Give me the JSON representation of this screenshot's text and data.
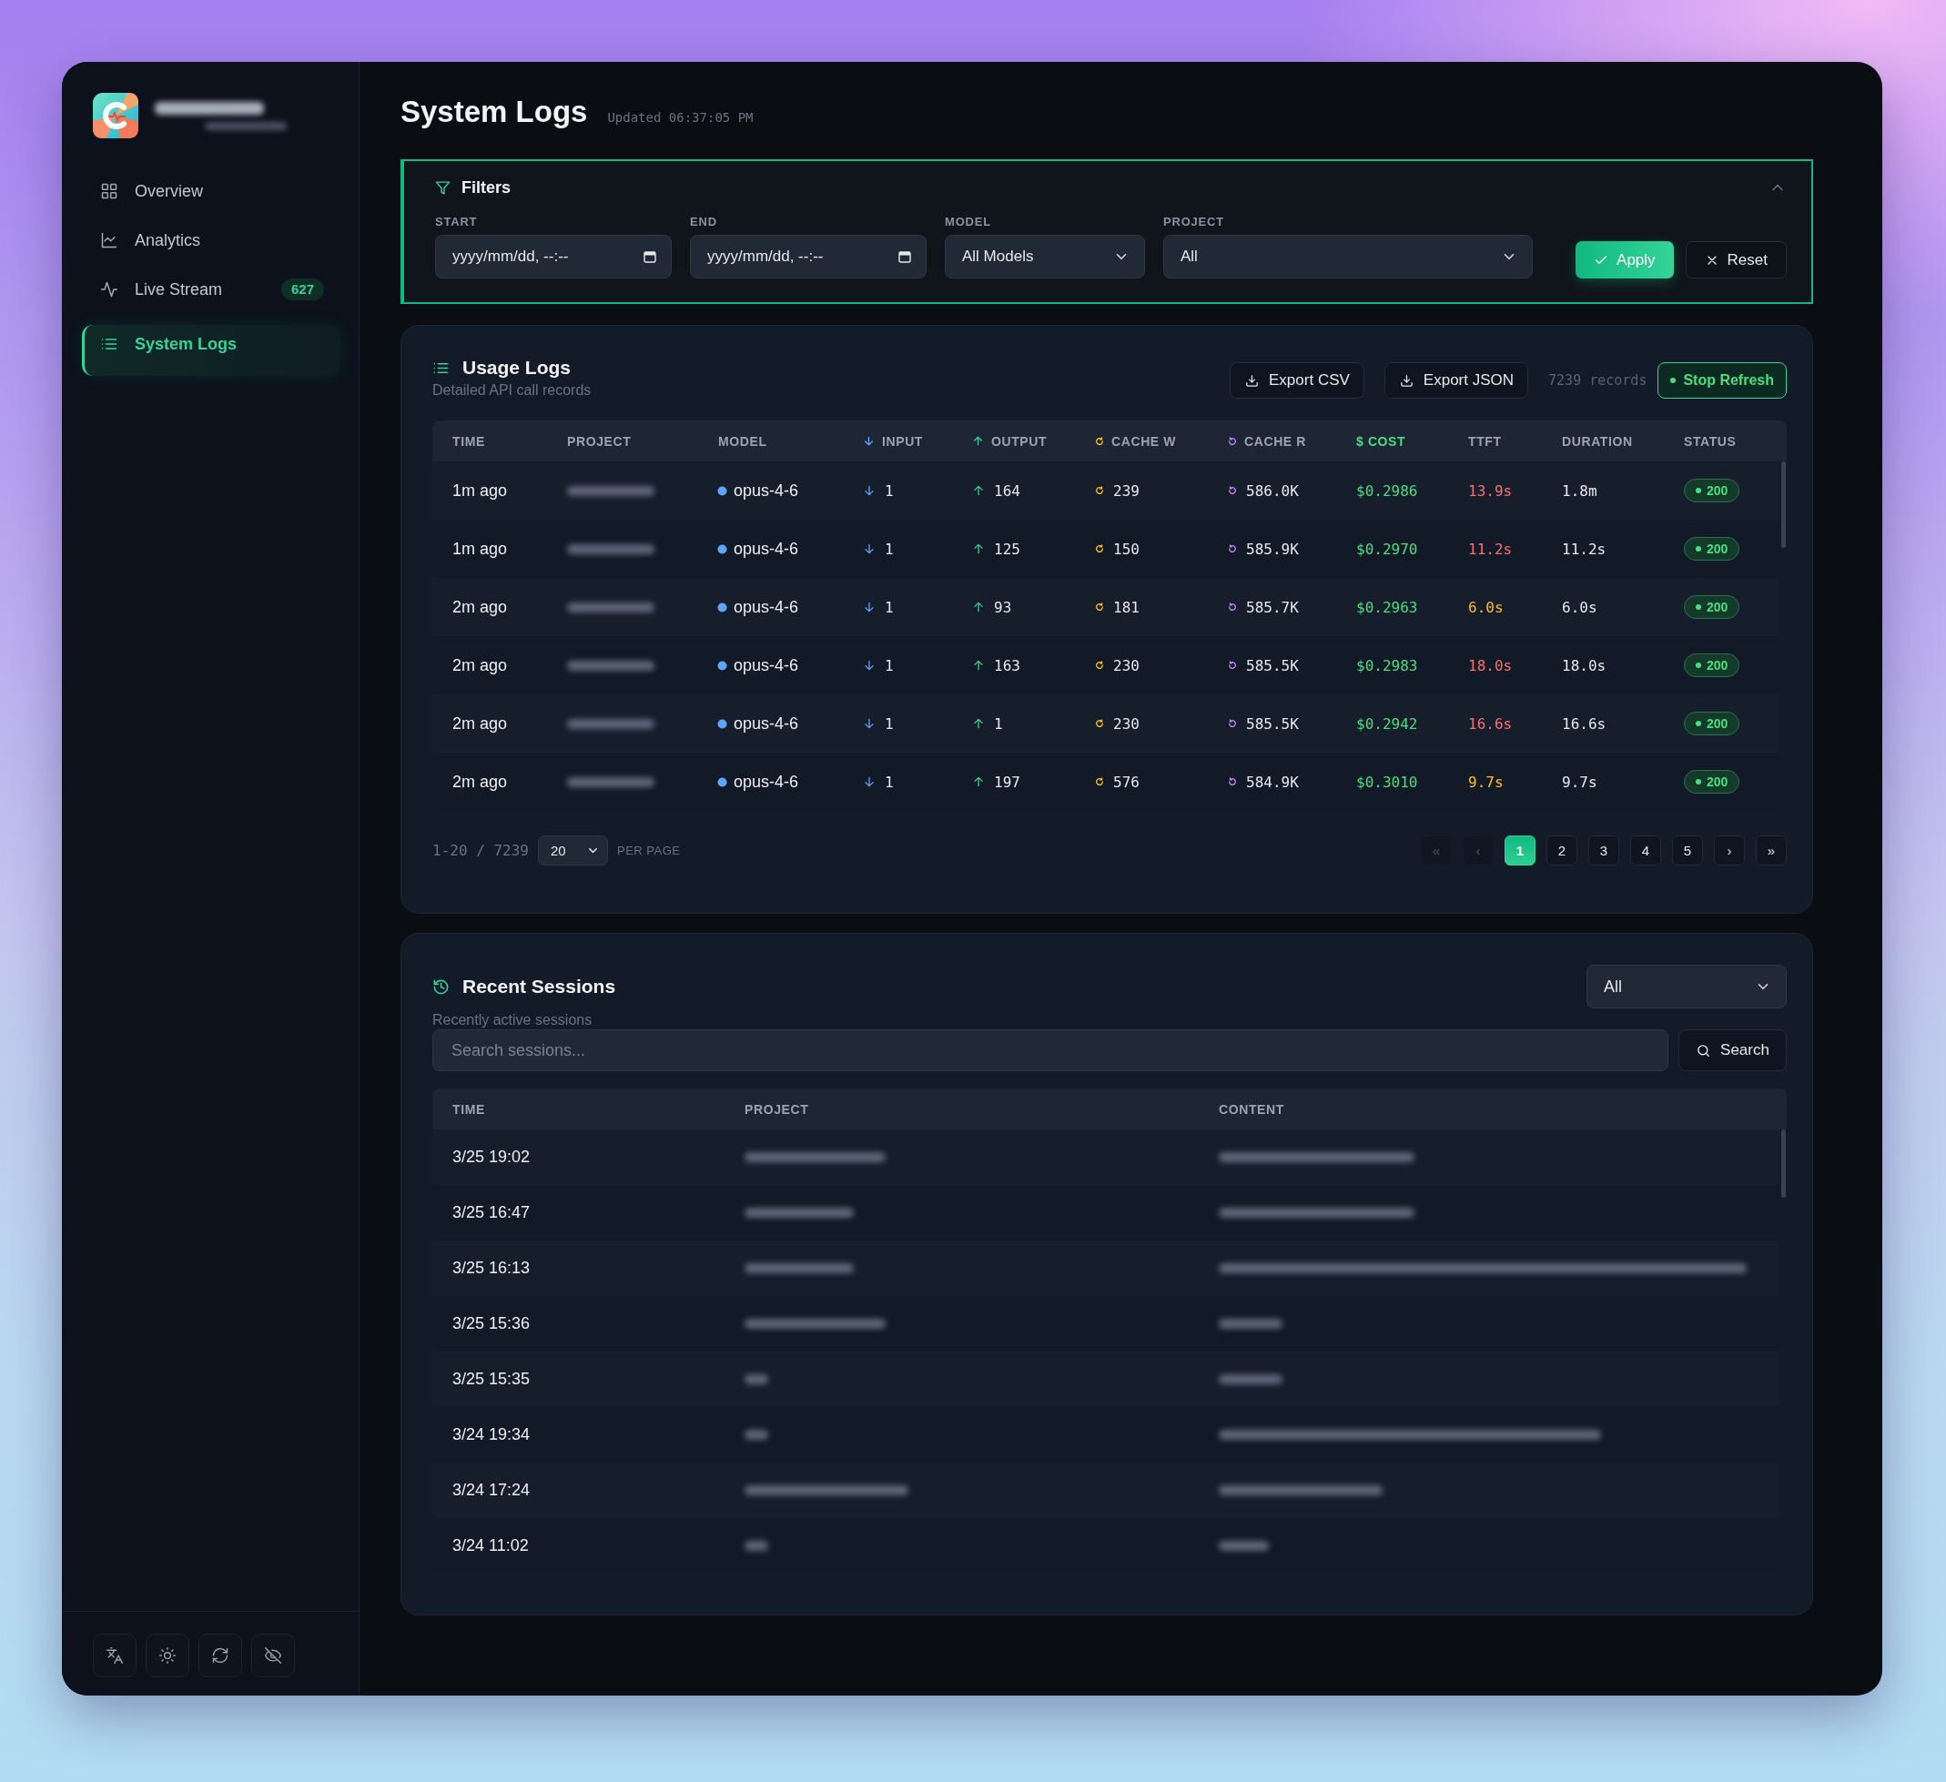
{
  "sidebar": {
    "items": [
      {
        "label": "Overview",
        "selected": false
      },
      {
        "label": "Analytics",
        "selected": false
      },
      {
        "label": "Live Stream",
        "badge": "627",
        "selected": false
      },
      {
        "label": "System Logs",
        "selected": true
      }
    ]
  },
  "header": {
    "title": "System Logs",
    "updated": "Updated 06:37:05 PM"
  },
  "filters": {
    "title": "Filters",
    "expanded": true,
    "fields": [
      {
        "label": "START",
        "kind": "datetime",
        "placeholder": "yyyy/mm/dd, --:--"
      },
      {
        "label": "END",
        "kind": "datetime",
        "placeholder": "yyyy/mm/dd, --:--"
      },
      {
        "label": "MODEL",
        "kind": "select",
        "value": "All Models"
      },
      {
        "label": "PROJECT",
        "kind": "select",
        "value": "All"
      }
    ],
    "buttons": [
      {
        "label": "Apply",
        "kind": "primary"
      },
      {
        "label": "Reset",
        "kind": "secondary"
      }
    ]
  },
  "usage_logs": {
    "title": "Usage Logs",
    "subtitle": "Detailed API call records",
    "exports": [
      {
        "label": "Export CSV"
      },
      {
        "label": "Export JSON"
      }
    ],
    "record_count": "7239 records",
    "refresh": {
      "label": "Stop Refresh",
      "on": true
    },
    "table": {
      "columns": [
        {
          "label": "TIME",
          "kind": "time"
        },
        {
          "label": "PROJECT",
          "kind": "project"
        },
        {
          "label": "MODEL",
          "kind": "model"
        },
        {
          "label": "INPUT",
          "kind": "input"
        },
        {
          "label": "OUTPUT",
          "kind": "output"
        },
        {
          "label": "CACHE W",
          "kind": "cache_write"
        },
        {
          "label": "CACHE R",
          "kind": "cache_read"
        },
        {
          "label": "$ COST",
          "kind": "cost"
        },
        {
          "label": "TTFT",
          "kind": "ttft"
        },
        {
          "label": "DURATION",
          "kind": "duration"
        },
        {
          "label": "STATUS",
          "kind": "status"
        }
      ],
      "rows": [
        {
          "time": "1m ago",
          "model": "opus-4-6",
          "input": "1",
          "output": "164",
          "cache_write": "239",
          "cache_read": "586.0K",
          "cost": "$0.2986",
          "ttft": "13.9s",
          "ttft_slow": true,
          "duration": "1.8m",
          "status": "200"
        },
        {
          "time": "1m ago",
          "model": "opus-4-6",
          "input": "1",
          "output": "125",
          "cache_write": "150",
          "cache_read": "585.9K",
          "cost": "$0.2970",
          "ttft": "11.2s",
          "ttft_slow": true,
          "duration": "11.2s",
          "status": "200"
        },
        {
          "time": "2m ago",
          "model": "opus-4-6",
          "input": "1",
          "output": "93",
          "cache_write": "181",
          "cache_read": "585.7K",
          "cost": "$0.2963",
          "ttft": "6.0s",
          "ttft_slow": false,
          "duration": "6.0s",
          "status": "200"
        },
        {
          "time": "2m ago",
          "model": "opus-4-6",
          "input": "1",
          "output": "163",
          "cache_write": "230",
          "cache_read": "585.5K",
          "cost": "$0.2983",
          "ttft": "18.0s",
          "ttft_slow": true,
          "duration": "18.0s",
          "status": "200"
        },
        {
          "time": "2m ago",
          "model": "opus-4-6",
          "input": "1",
          "output": "1",
          "cache_write": "230",
          "cache_read": "585.5K",
          "cost": "$0.2942",
          "ttft": "16.6s",
          "ttft_slow": true,
          "duration": "16.6s",
          "status": "200"
        },
        {
          "time": "2m ago",
          "model": "opus-4-6",
          "input": "1",
          "output": "197",
          "cache_write": "576",
          "cache_read": "584.9K",
          "cost": "$0.3010",
          "ttft": "9.7s",
          "ttft_slow": false,
          "duration": "9.7s",
          "status": "200"
        }
      ]
    },
    "pagination": {
      "range": "1-20 / 7239",
      "per_page": "20",
      "per_page_label": "PER PAGE",
      "pages": [
        {
          "label": "«",
          "selected": false,
          "disabled": true
        },
        {
          "label": "‹",
          "selected": false,
          "disabled": true
        },
        {
          "label": "1",
          "selected": true,
          "disabled": false
        },
        {
          "label": "2",
          "selected": false,
          "disabled": false
        },
        {
          "label": "3",
          "selected": false,
          "disabled": false
        },
        {
          "label": "4",
          "selected": false,
          "disabled": false
        },
        {
          "label": "5",
          "selected": false,
          "disabled": false
        },
        {
          "label": "›",
          "selected": false,
          "disabled": false
        },
        {
          "label": "»",
          "selected": false,
          "disabled": false
        }
      ]
    }
  },
  "recent_sessions": {
    "title": "Recent Sessions",
    "subtitle": "Recently active sessions",
    "filter": "All",
    "search": {
      "placeholder": "Search sessions...",
      "button": "Search"
    },
    "table": {
      "columns": [
        {
          "label": "TIME",
          "kind": "time"
        },
        {
          "label": "PROJECT",
          "kind": "project"
        },
        {
          "label": "CONTENT",
          "kind": "content"
        }
      ],
      "rows": [
        {
          "time": "3/25 19:02"
        },
        {
          "time": "3/25 16:47"
        },
        {
          "time": "3/25 16:13"
        },
        {
          "time": "3/25 15:36"
        },
        {
          "time": "3/25 15:35"
        },
        {
          "time": "3/24 19:34"
        },
        {
          "time": "3/24 17:24"
        },
        {
          "time": "3/24 11:02"
        }
      ]
    }
  }
}
